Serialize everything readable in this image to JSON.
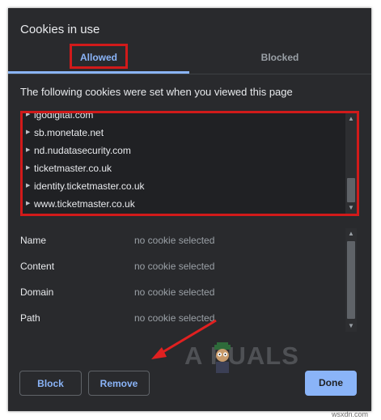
{
  "dialog": {
    "title": "Cookies in use",
    "tabs": [
      {
        "label": "Allowed",
        "active": true
      },
      {
        "label": "Blocked",
        "active": false
      }
    ],
    "description": "The following cookies were set when you viewed this page"
  },
  "cookies": [
    {
      "domain": "igodigital.com"
    },
    {
      "domain": "sb.monetate.net"
    },
    {
      "domain": "nd.nudatasecurity.com"
    },
    {
      "domain": "ticketmaster.co.uk"
    },
    {
      "domain": "identity.ticketmaster.co.uk"
    },
    {
      "domain": "www.ticketmaster.co.uk"
    }
  ],
  "details": [
    {
      "label": "Name",
      "value": "no cookie selected"
    },
    {
      "label": "Content",
      "value": "no cookie selected"
    },
    {
      "label": "Domain",
      "value": "no cookie selected"
    },
    {
      "label": "Path",
      "value": "no cookie selected"
    }
  ],
  "buttons": {
    "block": "Block",
    "remove": "Remove",
    "done": "Done"
  },
  "watermark": "A PUALS",
  "credit": "wsxdn.com",
  "colors": {
    "dialog_bg": "#292a2d",
    "accent": "#8ab4f8",
    "highlight_red": "#d11a1a",
    "annotation_arrow": "#e02020"
  },
  "icons": {
    "tree_expand": "triangle-right-icon",
    "scroll_up": "chevron-up-icon",
    "scroll_down": "chevron-down-icon"
  }
}
